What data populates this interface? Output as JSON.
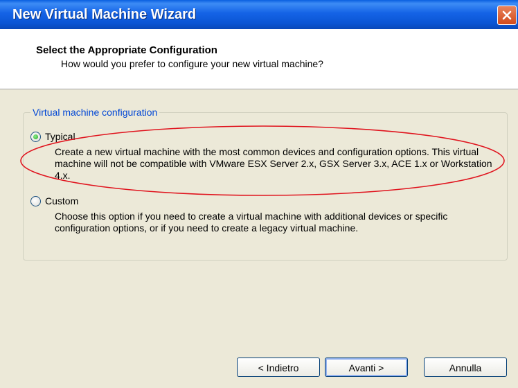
{
  "window": {
    "title": "New Virtual Machine Wizard",
    "close_icon": "close-icon"
  },
  "header": {
    "title": "Select the Appropriate Configuration",
    "subtitle": "How would you prefer to configure your new virtual machine?"
  },
  "config_group": {
    "label": "Virtual machine configuration",
    "options": [
      {
        "label": "Typical",
        "selected": true,
        "description": "Create a new virtual machine with the most common devices and configuration options. This virtual machine will not be compatible with VMware ESX Server 2.x, GSX Server 3.x, ACE 1.x or Workstation 4.x."
      },
      {
        "label": "Custom",
        "selected": false,
        "description": "Choose this option if you need to create a virtual machine with additional devices or specific configuration options, or if you need to create a legacy virtual machine."
      }
    ]
  },
  "buttons": {
    "back": "< Indietro",
    "next": "Avanti >",
    "cancel": "Annulla"
  },
  "colors": {
    "title_bar": "#0b55d4",
    "group_label": "#0046d5",
    "annotation_ellipse": "#e0141e",
    "close_button": "#d24a1c"
  }
}
